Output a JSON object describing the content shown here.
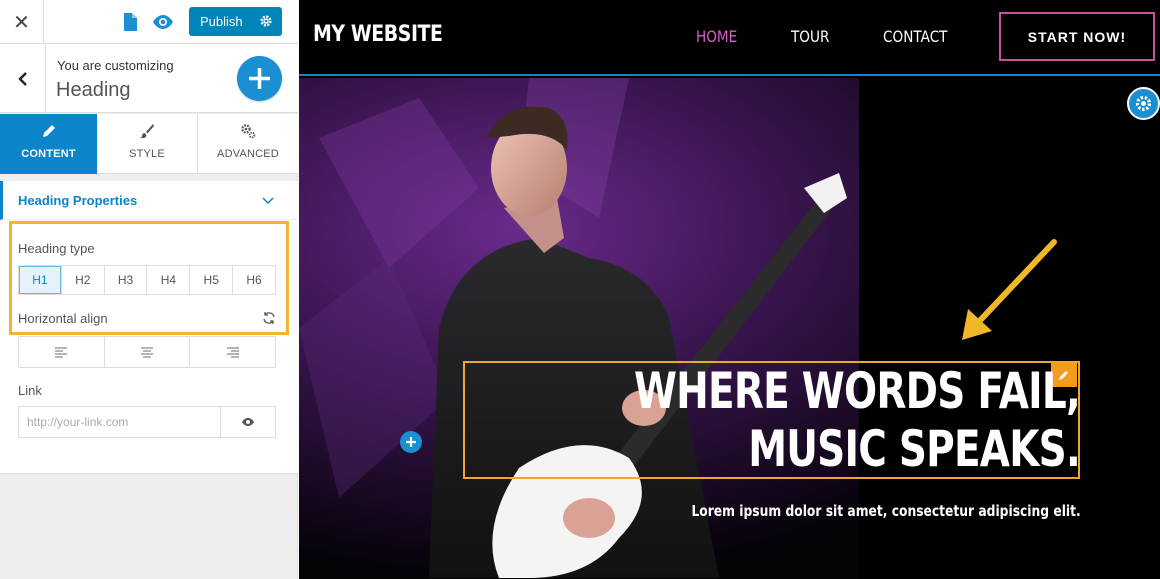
{
  "topbar": {
    "close_icon": "close-icon",
    "publish_label": "Publish"
  },
  "customize": {
    "label": "You are customizing",
    "title": "Heading"
  },
  "tabs": [
    {
      "label": "CONTENT",
      "icon": "pencil-icon",
      "active": true
    },
    {
      "label": "STYLE",
      "icon": "brush-icon",
      "active": false
    },
    {
      "label": "ADVANCED",
      "icon": "gears-icon",
      "active": false
    }
  ],
  "properties": {
    "section_title": "Heading Properties",
    "heading_type_label": "Heading type",
    "heading_types": [
      "H1",
      "H2",
      "H3",
      "H4",
      "H5",
      "H6"
    ],
    "selected_heading_type": "H1",
    "horizontal_align_label": "Horizontal align",
    "align_options": [
      "align-left-icon",
      "align-center-icon",
      "align-right-icon"
    ],
    "link_label": "Link",
    "link_placeholder": "http://your-link.com"
  },
  "site": {
    "logo": "MY WEBSITE",
    "nav": [
      {
        "label": "HOME",
        "active": true
      },
      {
        "label": "TOUR",
        "active": false
      },
      {
        "label": "CONTACT",
        "active": false
      }
    ],
    "cta": "START NOW!",
    "heading_line1": "WHERE WORDS FAIL,",
    "heading_line2": "MUSIC SPEAKS.",
    "subtext": "Lorem ipsum dolor sit amet, consectetur adipiscing elit."
  },
  "colors": {
    "accent_blue": "#0b84c9",
    "highlight_yellow": "#f0b826",
    "nav_active": "#d062c2",
    "cta_border": "#c9509f",
    "edit_orange": "#f29d1d"
  }
}
